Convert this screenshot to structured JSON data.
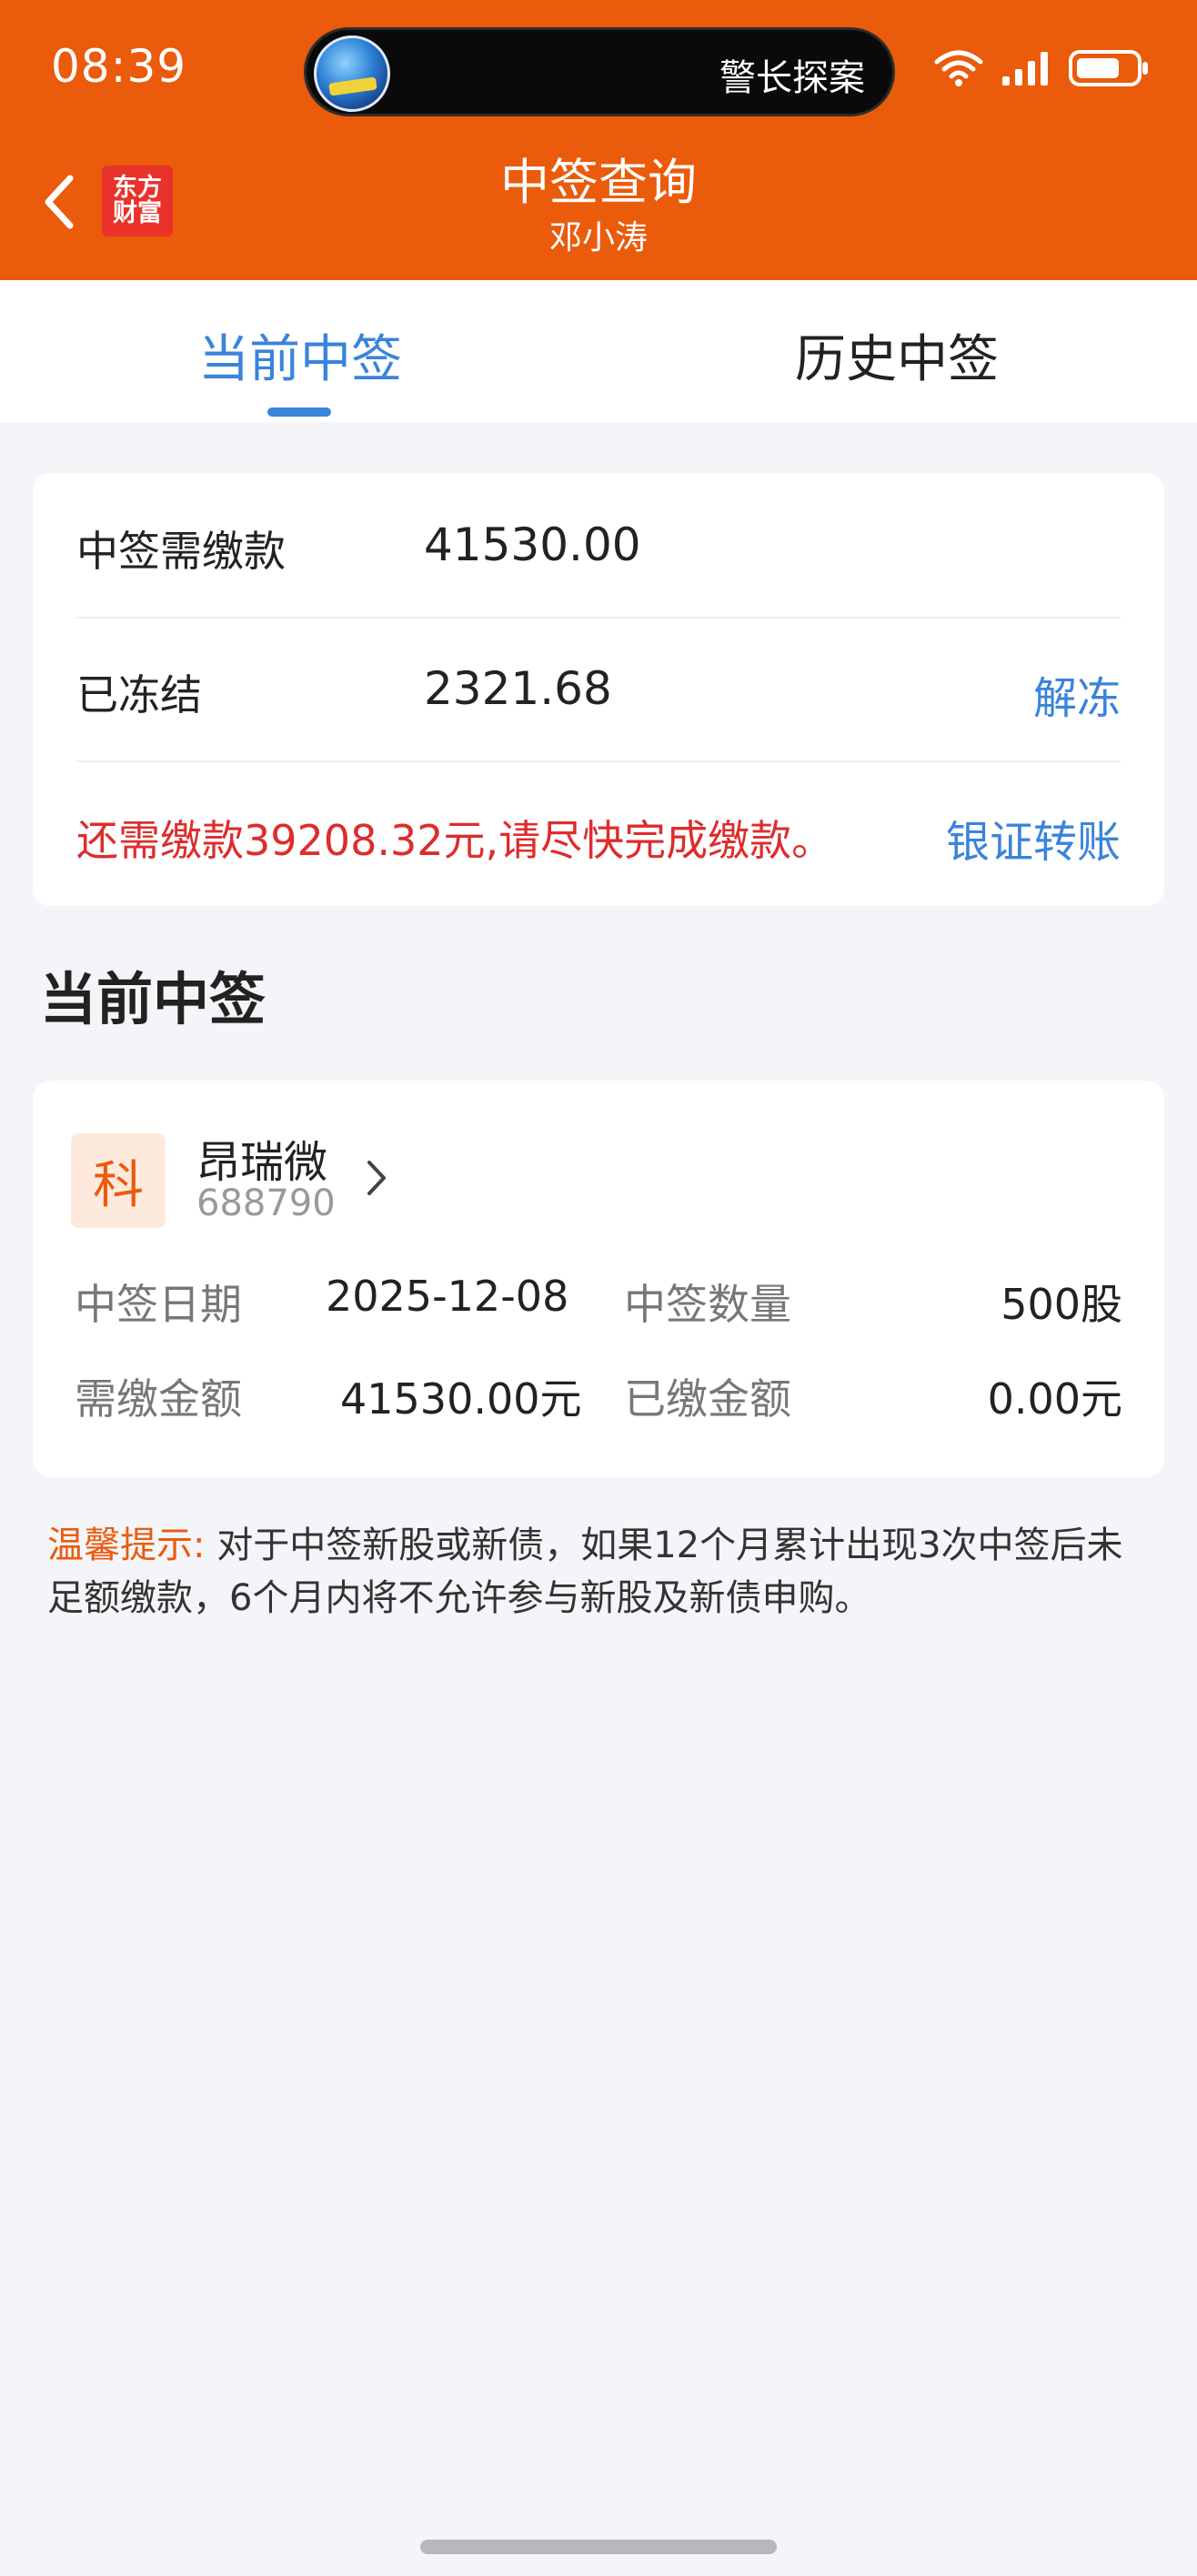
{
  "status_bar": {
    "time": "08:39",
    "island_text": "警长探案"
  },
  "header": {
    "logo_line1": "东方",
    "logo_line2": "财富",
    "title": "中签查询",
    "subtitle": "邓小涛",
    "brand_color": "#ea5b0c"
  },
  "tabs": [
    {
      "label": "当前中签",
      "active": true
    },
    {
      "label": "历史中签",
      "active": false
    }
  ],
  "summary": {
    "payable_label": "中签需缴款",
    "payable_value": "41530.00",
    "frozen_label": "已冻结",
    "frozen_value": "2321.68",
    "unfreeze_label": "解冻",
    "remaining_text": "还需缴款39208.32元,请尽快完成缴款。",
    "transfer_label": "银证转账"
  },
  "section_title": "当前中签",
  "stock": {
    "market_badge": "科",
    "name": "昂瑞微",
    "code": "688790",
    "win_date_label": "中签日期",
    "win_date_value": "2025-12-08",
    "win_qty_label": "中签数量",
    "win_qty_value": "500股",
    "due_label": "需缴金额",
    "due_value": "41530.00元",
    "paid_label": "已缴金额",
    "paid_value": "0.00元"
  },
  "tip": {
    "label": "温馨提示:",
    "text": "对于中签新股或新债，如果12个月累计出现3次中签后未足额缴款，6个月内将不允许参与新股及新债申购。"
  },
  "colors": {
    "accent_blue": "#3a84da",
    "warning_red": "#dd2d2d",
    "background": "#f4f5f9"
  }
}
